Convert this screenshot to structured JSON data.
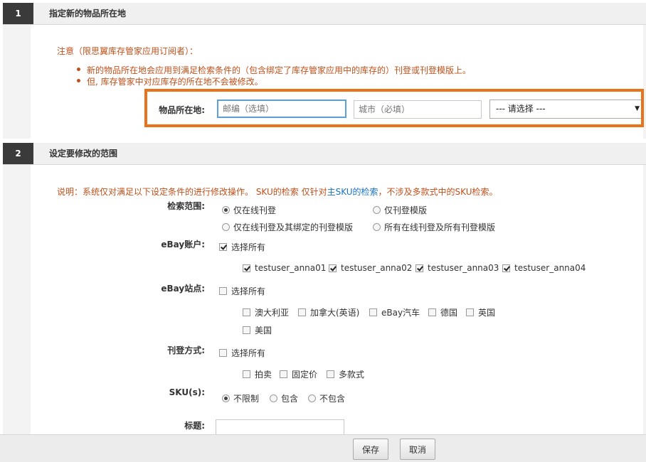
{
  "section1": {
    "number": "1",
    "title": "指定新的物品所在地",
    "note_title": "注意（限思翼库存管家应用订阅者）：",
    "bullets": [
      "新的物品所在地会应用到满足检索条件的（包含绑定了库存管家应用中的库存的）刊登或刊登模版上。",
      "但, 库存管家中对应库存的所在地不会被修改。"
    ],
    "location_label": "物品所在地:",
    "zip_placeholder": "邮编（选填）",
    "city_placeholder": "城市（必填）",
    "select_value": "--- 请选择 ---"
  },
  "section2": {
    "number": "2",
    "title": "设定要修改的范围",
    "desc_prefix": "说明：系统仅对满足以下设定条件的进行修改操作。 SKU的检索 仅针对",
    "desc_link": "主SKU的检索",
    "desc_suffix": "，不涉及多款式中的SKU检索。",
    "scope": {
      "label": "检索范围:",
      "options": [
        "仅在线刊登",
        "仅刊登模版",
        "仅在线刊登及其绑定的刊登模版",
        "所有在线刊登及所有刊登模版"
      ],
      "selected": "仅在线刊登"
    },
    "accounts": {
      "label": "eBay账户:",
      "select_all": "选择所有",
      "items": [
        "testuser_anna01",
        "testuser_anna02",
        "testuser_anna03",
        "testuser_anna04"
      ]
    },
    "sites": {
      "label": "eBay站点:",
      "select_all": "选择所有",
      "items": [
        "澳大利亚",
        "加拿大(英语)",
        "eBay汽车",
        "德国",
        "英国",
        "美国"
      ]
    },
    "listing_type": {
      "label": "刊登方式:",
      "select_all": "选择所有",
      "items": [
        "拍卖",
        "固定价",
        "多款式"
      ]
    },
    "sku": {
      "label": "SKU(s):",
      "options": [
        "不限制",
        "包含",
        "不包含"
      ],
      "selected": "不限制"
    },
    "title_label": "标题:"
  },
  "footer": {
    "save": "保存",
    "cancel": "取消"
  },
  "colors": {
    "accent_orange": "#e8731a",
    "note_text": "#c0501b",
    "link": "#1a73c4"
  }
}
